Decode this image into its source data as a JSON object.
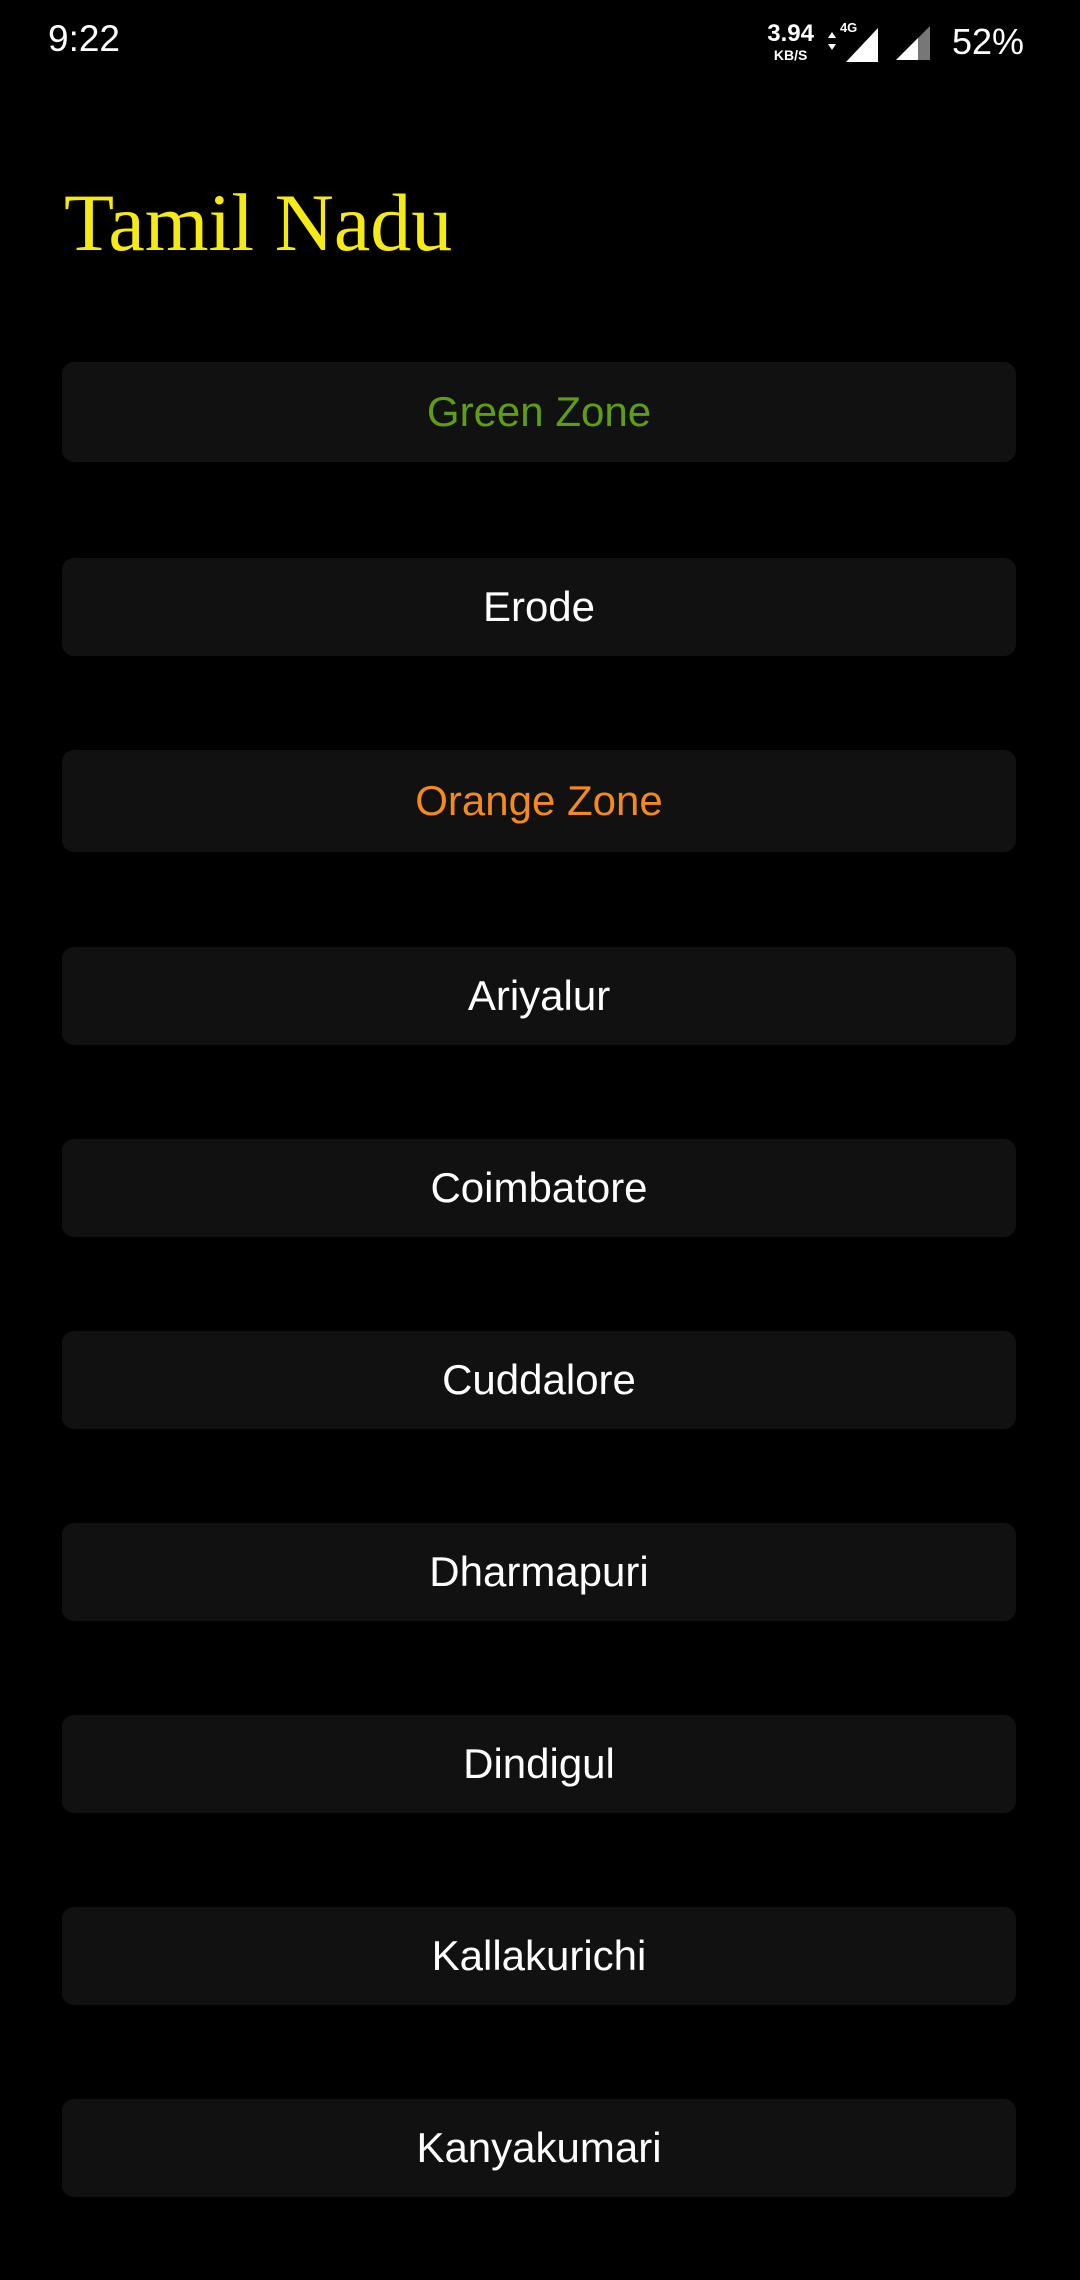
{
  "status_bar": {
    "time": "9:22",
    "net_speed_value": "3.94",
    "net_speed_unit": "KB/S",
    "network_type": "4G",
    "battery": "52%"
  },
  "title": "Tamil Nadu",
  "colors": {
    "title": "#f5ea14",
    "green_zone": "#5f9e12",
    "orange_zone": "#f58a1c",
    "item_background": "#111111",
    "background": "#000000"
  },
  "items": [
    {
      "label": "Green Zone",
      "kind": "zone-green"
    },
    {
      "label": "Erode",
      "kind": "district"
    },
    {
      "label": "Orange Zone",
      "kind": "zone-orange"
    },
    {
      "label": "Ariyalur",
      "kind": "district"
    },
    {
      "label": "Coimbatore",
      "kind": "district"
    },
    {
      "label": "Cuddalore",
      "kind": "district"
    },
    {
      "label": "Dharmapuri",
      "kind": "district"
    },
    {
      "label": "Dindigul",
      "kind": "district"
    },
    {
      "label": "Kallakurichi",
      "kind": "district"
    },
    {
      "label": "Kanyakumari",
      "kind": "district"
    }
  ]
}
